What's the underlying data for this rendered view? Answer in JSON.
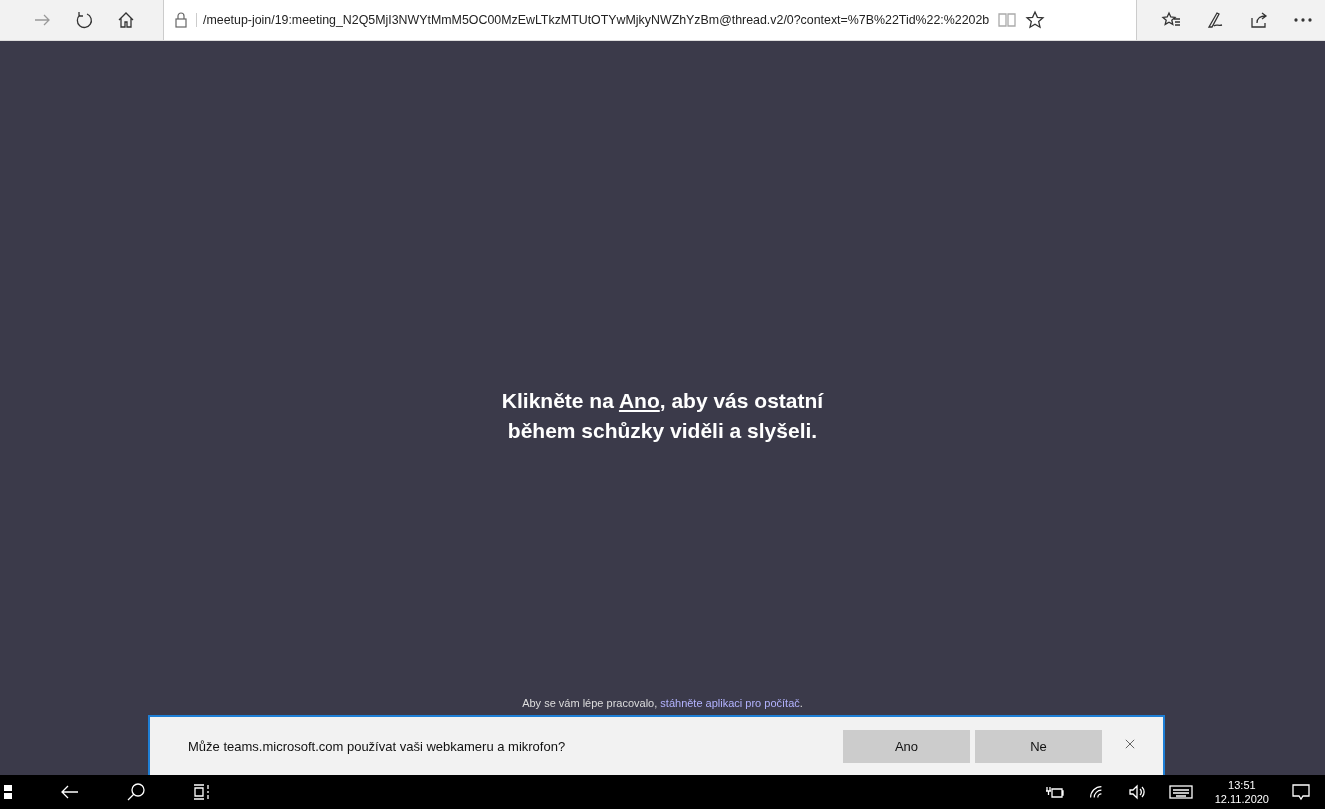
{
  "browser": {
    "url": "/meetup-join/19:meeting_N2Q5MjI3NWYtMmM5OC00MzEwLTkzMTUtOTYwMjkyNWZhYzBm@thread.v2/0?context=%7B%22Tid%22:%2202b"
  },
  "message": {
    "prefix": "Klikněte na ",
    "link": "Ano",
    "suffix": ", aby vás ostatní během schůzky viděli a slyšeli."
  },
  "hint": {
    "prefix": "Aby se vám lépe pracovalo, ",
    "link": "stáhněte aplikaci pro počítač",
    "suffix": "."
  },
  "permission_bar": {
    "question": "Může teams.microsoft.com používat vaši webkameru a mikrofon?",
    "buttons": [
      "Ano",
      "Ne"
    ]
  },
  "taskbar": {
    "time": "13:51",
    "date": "12.11.2020"
  }
}
